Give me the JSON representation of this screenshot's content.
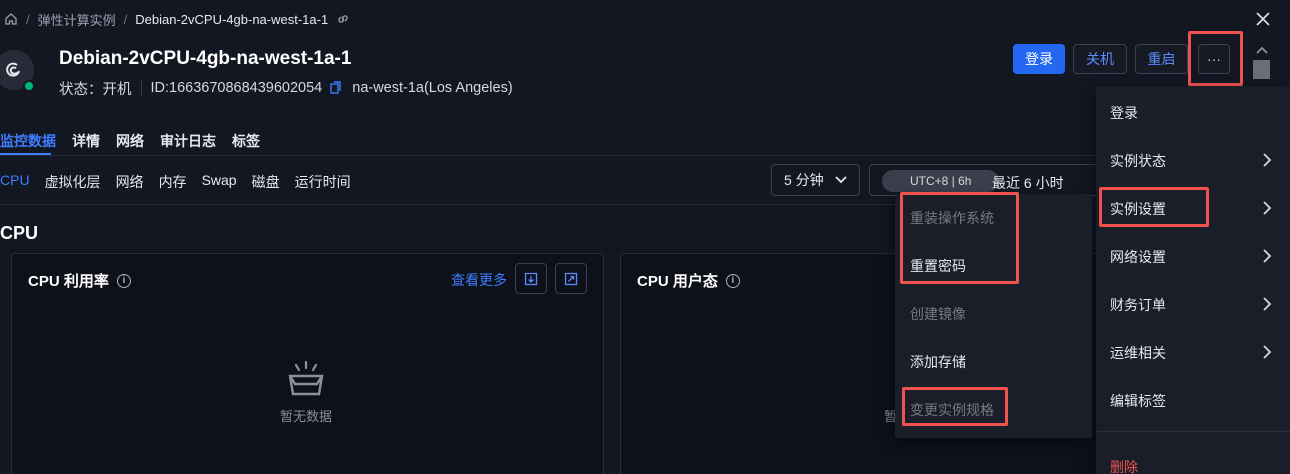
{
  "breadcrumb": {
    "items": [
      "弹性计算实例",
      "Debian-2vCPU-4gb-na-west-1a-1"
    ]
  },
  "instance": {
    "name": "Debian-2vCPU-4gb-na-west-1a-1",
    "status_label": "状态：",
    "status_value": "开机",
    "id_text": "ID:1663670868439602054",
    "region": "na-west-1a(Los Angeles)"
  },
  "actions": {
    "login": "登录",
    "shutdown": "关机",
    "restart": "重启",
    "more": "···"
  },
  "tabs": [
    {
      "label": "监控数据",
      "active": true
    },
    {
      "label": "详情"
    },
    {
      "label": "网络"
    },
    {
      "label": "审计日志"
    },
    {
      "label": "标签"
    }
  ],
  "subtabs": [
    {
      "label": "CPU",
      "active": true
    },
    {
      "label": "虚拟化层"
    },
    {
      "label": "网络"
    },
    {
      "label": "内存"
    },
    {
      "label": "Swap"
    },
    {
      "label": "磁盘"
    },
    {
      "label": "运行时间"
    }
  ],
  "controls": {
    "interval": "5 分钟",
    "timezone_pill": "UTC+8 | 6h",
    "range": "最近 6 小时"
  },
  "section_title": "CPU",
  "cards": {
    "cpu_usage": {
      "title": "CPU 利用率",
      "more": "查看更多",
      "empty": "暂无数据"
    },
    "cpu_user": {
      "title": "CPU 用户态",
      "stray": "暂"
    }
  },
  "menu": {
    "items": [
      {
        "label": "登录",
        "submenu": false
      },
      {
        "label": "实例状态",
        "submenu": true
      },
      {
        "label": "实例设置",
        "submenu": true,
        "highlighted": true
      },
      {
        "label": "网络设置",
        "submenu": true
      },
      {
        "label": "财务订单",
        "submenu": true
      },
      {
        "label": "运维相关",
        "submenu": true
      },
      {
        "label": "编辑标签",
        "submenu": false
      }
    ],
    "delete": "删除"
  },
  "submenu": {
    "items": [
      {
        "label": "重装操作系统",
        "disabled": true
      },
      {
        "label": "重置密码",
        "disabled": false
      },
      {
        "label": "创建镜像",
        "disabled": true
      },
      {
        "label": "添加存储",
        "disabled": false
      },
      {
        "label": "变更实例规格",
        "disabled": true
      }
    ]
  },
  "colors": {
    "accent": "#2468f2",
    "link": "#3d7dff",
    "success": "#00b578",
    "highlight": "#f0534f",
    "background": "#131722"
  }
}
